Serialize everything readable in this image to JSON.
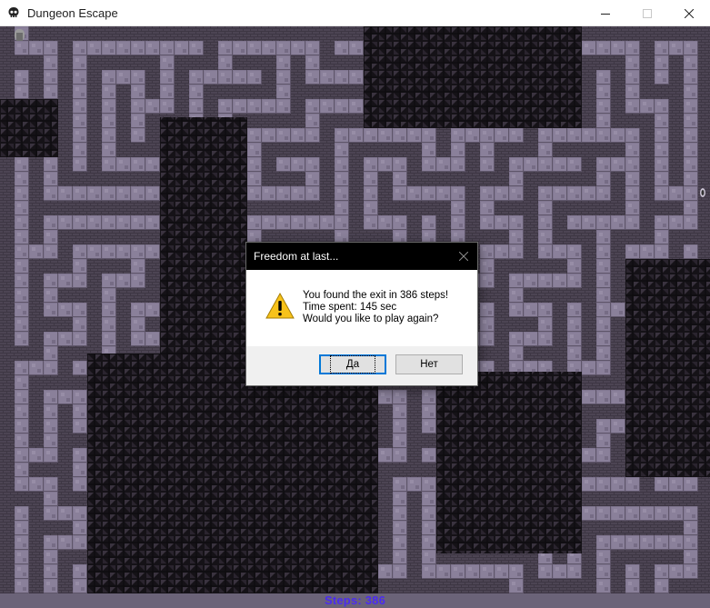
{
  "window": {
    "title": "Dungeon Escape",
    "icon": "skull-icon",
    "controls": [
      "minimize-icon",
      "maximize-icon",
      "close-icon"
    ]
  },
  "game": {
    "steps_label": "Steps: 386",
    "colors": {
      "wall": "#151217",
      "wall_dark": "#2b2630",
      "path": "#817791",
      "path_light": "#9a90a8",
      "path_edge": "#5e5569"
    }
  },
  "dialog": {
    "title": "Freedom at last...",
    "icon": "warning-icon",
    "message_line1": "You found the exit in 386 steps!",
    "message_line2": "Time spent: 145 sec",
    "message_line3": "Would you like to play again?",
    "yes_label": "Да",
    "no_label": "Нет"
  }
}
